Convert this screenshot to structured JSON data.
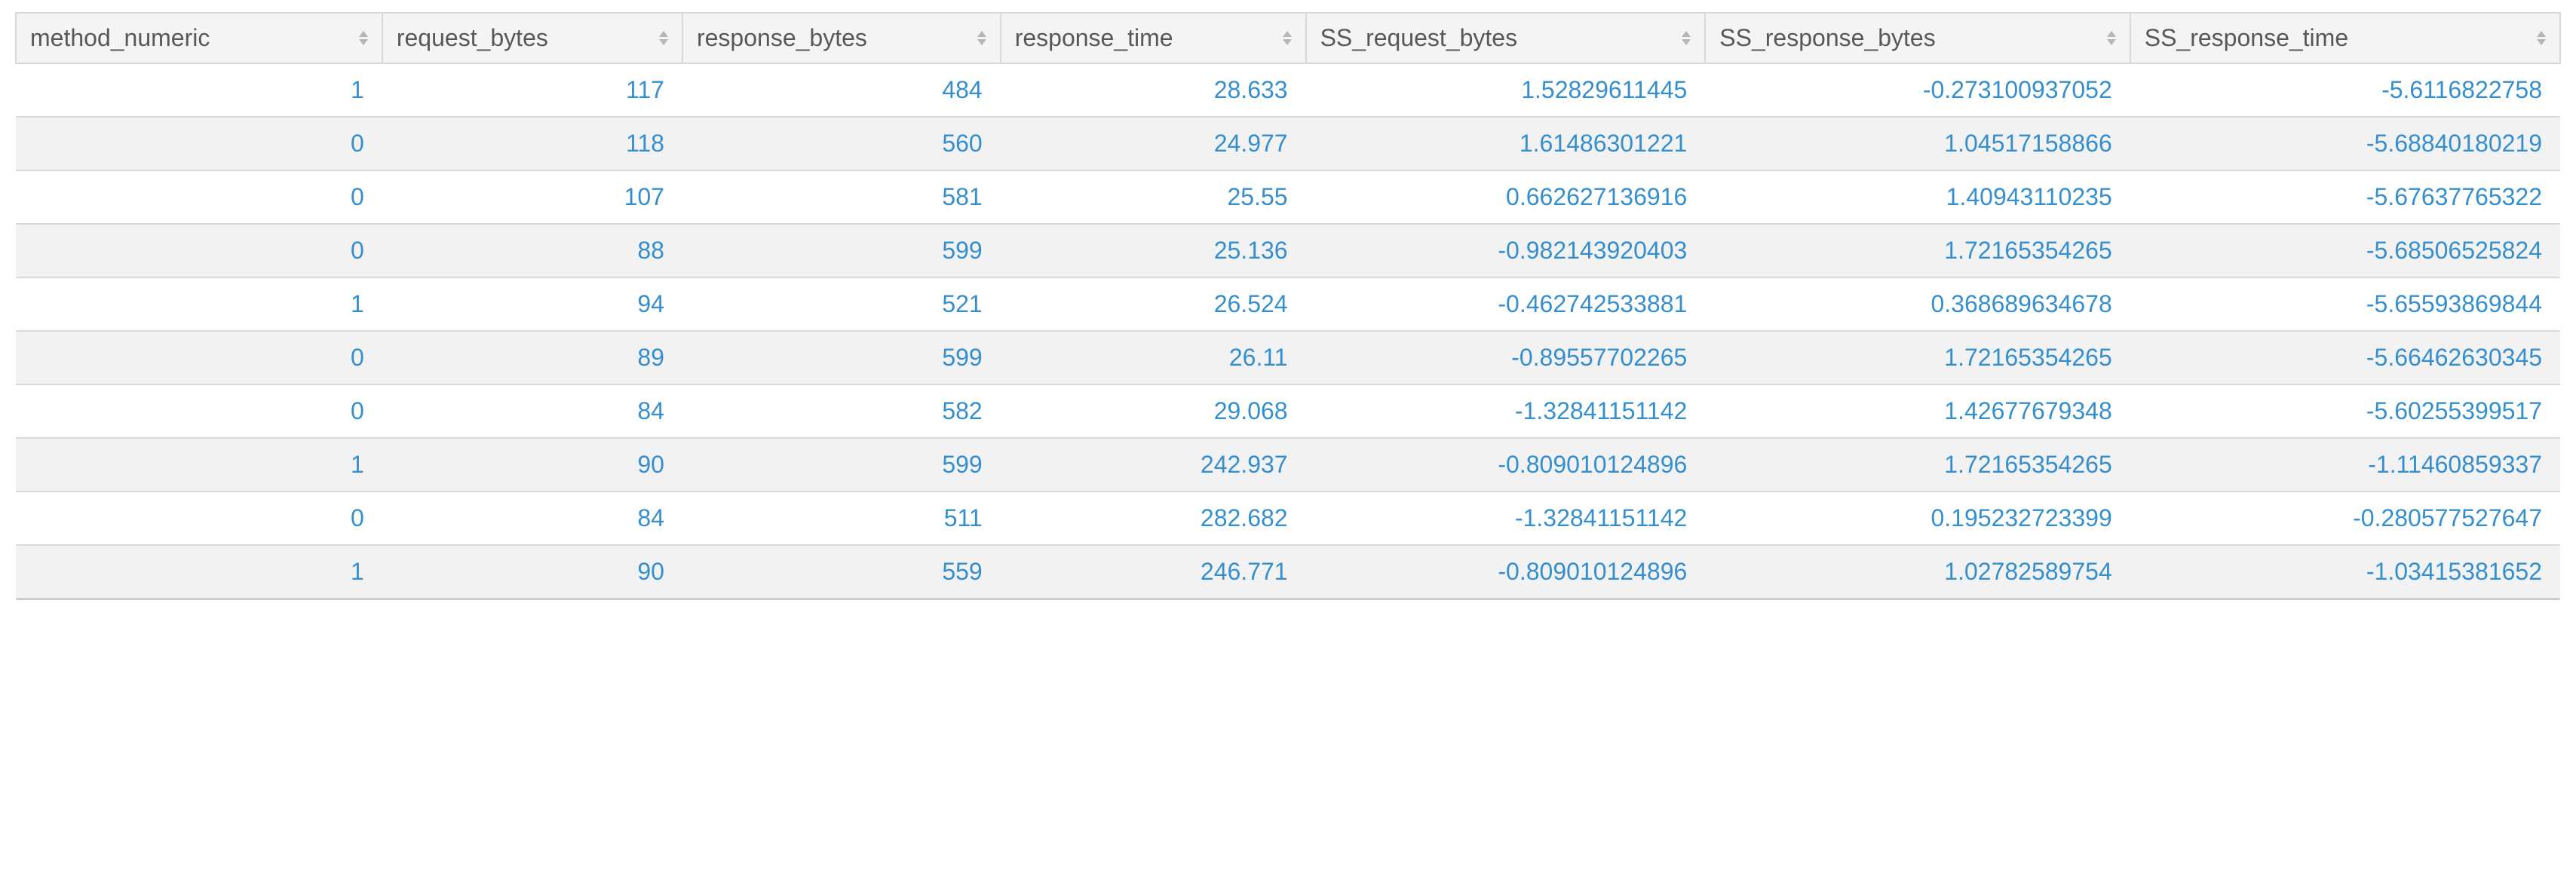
{
  "colors": {
    "cell_text": "#358fcf",
    "header_text": "#55595c",
    "border": "#d9d9d9",
    "row_alt_bg": "#f2f2f2",
    "header_bg": "#f4f4f4",
    "sort_arrow": "#b6b6b6"
  },
  "table": {
    "columns": [
      "method_numeric",
      "request_bytes",
      "response_bytes",
      "response_time",
      "SS_request_bytes",
      "SS_response_bytes",
      "SS_response_time"
    ],
    "rows": [
      {
        "method_numeric": "1",
        "request_bytes": "117",
        "response_bytes": "484",
        "response_time": "28.633",
        "SS_request_bytes": "1.52829611445",
        "SS_response_bytes": "-0.273100937052",
        "SS_response_time": "-5.6116822758"
      },
      {
        "method_numeric": "0",
        "request_bytes": "118",
        "response_bytes": "560",
        "response_time": "24.977",
        "SS_request_bytes": "1.61486301221",
        "SS_response_bytes": "1.04517158866",
        "SS_response_time": "-5.68840180219"
      },
      {
        "method_numeric": "0",
        "request_bytes": "107",
        "response_bytes": "581",
        "response_time": "25.55",
        "SS_request_bytes": "0.662627136916",
        "SS_response_bytes": "1.40943110235",
        "SS_response_time": "-5.67637765322"
      },
      {
        "method_numeric": "0",
        "request_bytes": "88",
        "response_bytes": "599",
        "response_time": "25.136",
        "SS_request_bytes": "-0.982143920403",
        "SS_response_bytes": "1.72165354265",
        "SS_response_time": "-5.68506525824"
      },
      {
        "method_numeric": "1",
        "request_bytes": "94",
        "response_bytes": "521",
        "response_time": "26.524",
        "SS_request_bytes": "-0.462742533881",
        "SS_response_bytes": "0.368689634678",
        "SS_response_time": "-5.65593869844"
      },
      {
        "method_numeric": "0",
        "request_bytes": "89",
        "response_bytes": "599",
        "response_time": "26.11",
        "SS_request_bytes": "-0.89557702265",
        "SS_response_bytes": "1.72165354265",
        "SS_response_time": "-5.66462630345"
      },
      {
        "method_numeric": "0",
        "request_bytes": "84",
        "response_bytes": "582",
        "response_time": "29.068",
        "SS_request_bytes": "-1.32841151142",
        "SS_response_bytes": "1.42677679348",
        "SS_response_time": "-5.60255399517"
      },
      {
        "method_numeric": "1",
        "request_bytes": "90",
        "response_bytes": "599",
        "response_time": "242.937",
        "SS_request_bytes": "-0.809010124896",
        "SS_response_bytes": "1.72165354265",
        "SS_response_time": "-1.11460859337"
      },
      {
        "method_numeric": "0",
        "request_bytes": "84",
        "response_bytes": "511",
        "response_time": "282.682",
        "SS_request_bytes": "-1.32841151142",
        "SS_response_bytes": "0.195232723399",
        "SS_response_time": "-0.280577527647"
      },
      {
        "method_numeric": "1",
        "request_bytes": "90",
        "response_bytes": "559",
        "response_time": "246.771",
        "SS_request_bytes": "-0.809010124896",
        "SS_response_bytes": "1.02782589754",
        "SS_response_time": "-1.03415381652"
      }
    ]
  }
}
